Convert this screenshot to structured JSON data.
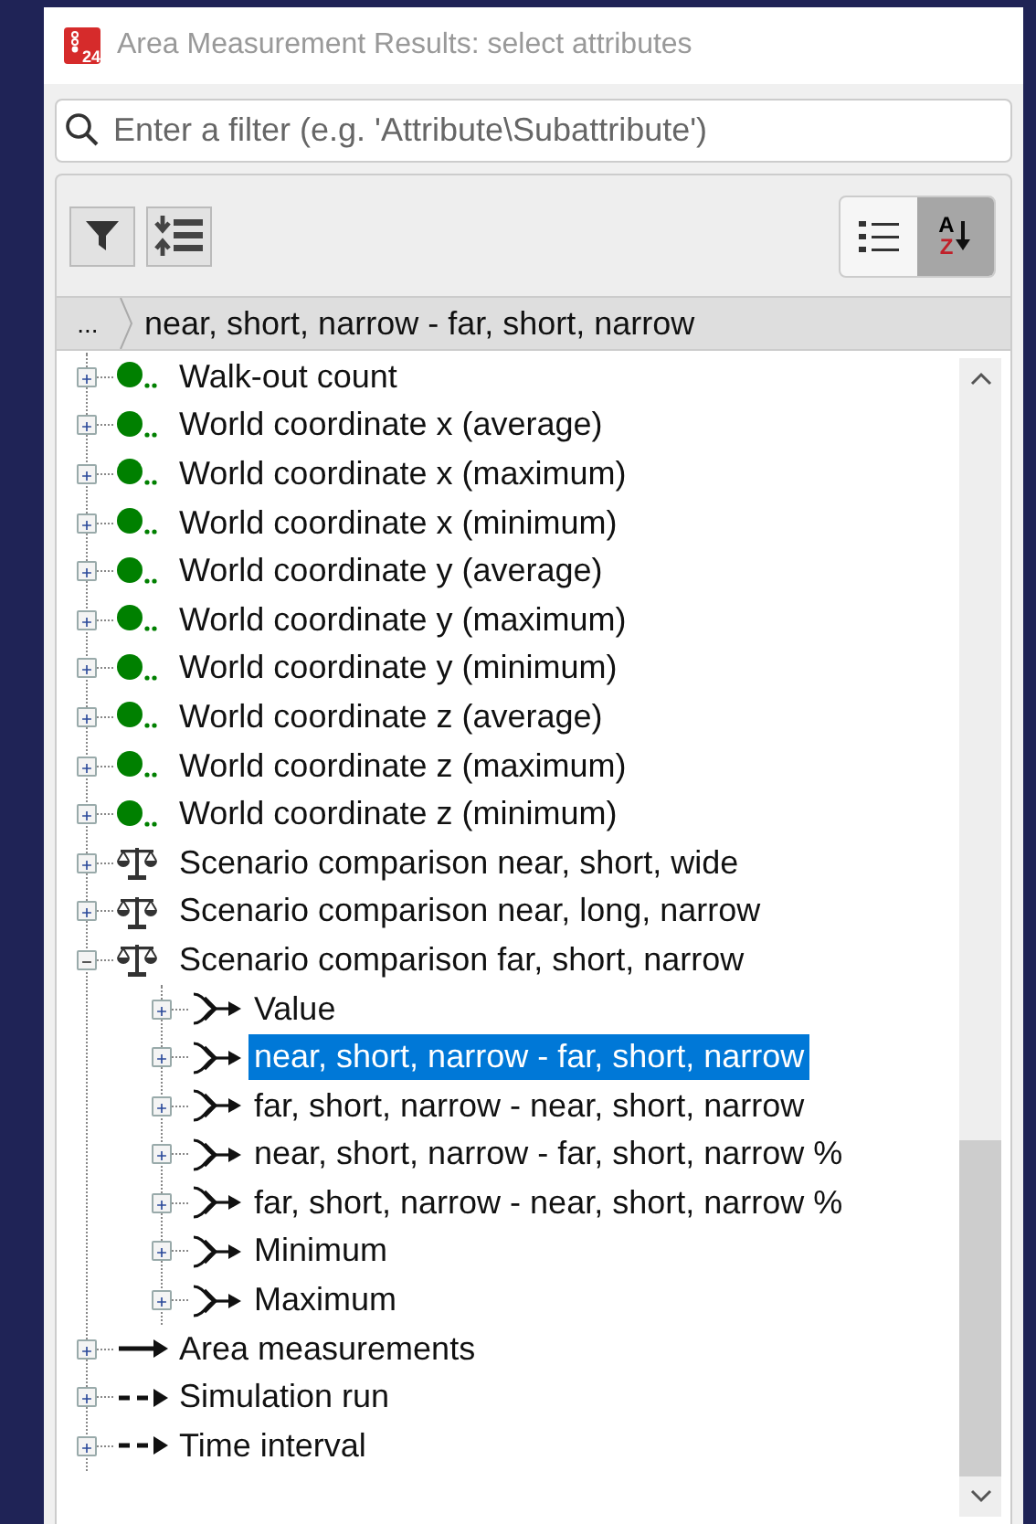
{
  "window": {
    "title": "Area Measurement Results: select attributes",
    "app_icon_text": "24"
  },
  "filter": {
    "placeholder": "Enter a filter (e.g. 'Attribute\\Subattribute')"
  },
  "toolbar": {
    "view_buttons": [
      {
        "kind": "list",
        "selected": false
      },
      {
        "kind": "sort",
        "selected": true,
        "letters": [
          "A",
          "Z"
        ]
      }
    ]
  },
  "breadcrumb": {
    "ellipsis": "...",
    "current": "near, short, narrow - far, short, narrow"
  },
  "tree": [
    {
      "label": "Walk-out count",
      "kind": "dot",
      "expanded": false,
      "selected": false
    },
    {
      "label": "World coordinate x (average)",
      "kind": "dot",
      "expanded": false,
      "selected": false
    },
    {
      "label": "World coordinate x (maximum)",
      "kind": "dot",
      "expanded": false,
      "selected": false
    },
    {
      "label": "World coordinate x (minimum)",
      "kind": "dot",
      "expanded": false,
      "selected": false
    },
    {
      "label": "World coordinate y (average)",
      "kind": "dot",
      "expanded": false,
      "selected": false
    },
    {
      "label": "World coordinate y (maximum)",
      "kind": "dot",
      "expanded": false,
      "selected": false
    },
    {
      "label": "World coordinate y (minimum)",
      "kind": "dot",
      "expanded": false,
      "selected": false
    },
    {
      "label": "World coordinate z (average)",
      "kind": "dot",
      "expanded": false,
      "selected": false
    },
    {
      "label": "World coordinate z (maximum)",
      "kind": "dot",
      "expanded": false,
      "selected": false
    },
    {
      "label": "World coordinate z (minimum)",
      "kind": "dot",
      "expanded": false,
      "selected": false
    },
    {
      "label": "Scenario comparison near, short, wide",
      "kind": "scale",
      "expanded": false,
      "selected": false
    },
    {
      "label": "Scenario comparison near, long, narrow",
      "kind": "scale",
      "expanded": false,
      "selected": false
    },
    {
      "label": "Scenario comparison far, short, narrow",
      "kind": "scale",
      "expanded": true,
      "selected": false,
      "children": [
        {
          "label": "Value",
          "kind": "fork",
          "expanded": false,
          "selected": false
        },
        {
          "label": "near, short, narrow - far, short, narrow",
          "kind": "fork",
          "expanded": false,
          "selected": true
        },
        {
          "label": "far, short, narrow - near, short, narrow",
          "kind": "fork",
          "expanded": false,
          "selected": false
        },
        {
          "label": "near, short, narrow - far, short, narrow %",
          "kind": "fork",
          "expanded": false,
          "selected": false
        },
        {
          "label": "far, short, narrow - near, short, narrow %",
          "kind": "fork",
          "expanded": false,
          "selected": false
        },
        {
          "label": "Minimum",
          "kind": "fork",
          "expanded": false,
          "selected": false
        },
        {
          "label": "Maximum",
          "kind": "fork",
          "expanded": false,
          "selected": false
        }
      ]
    },
    {
      "label": "Area measurements",
      "kind": "arrow",
      "expanded": false,
      "selected": false
    },
    {
      "label": "Simulation run",
      "kind": "dashed-arrow",
      "expanded": false,
      "selected": false
    },
    {
      "label": "Time interval",
      "kind": "dashed-arrow",
      "expanded": false,
      "selected": false
    }
  ]
}
